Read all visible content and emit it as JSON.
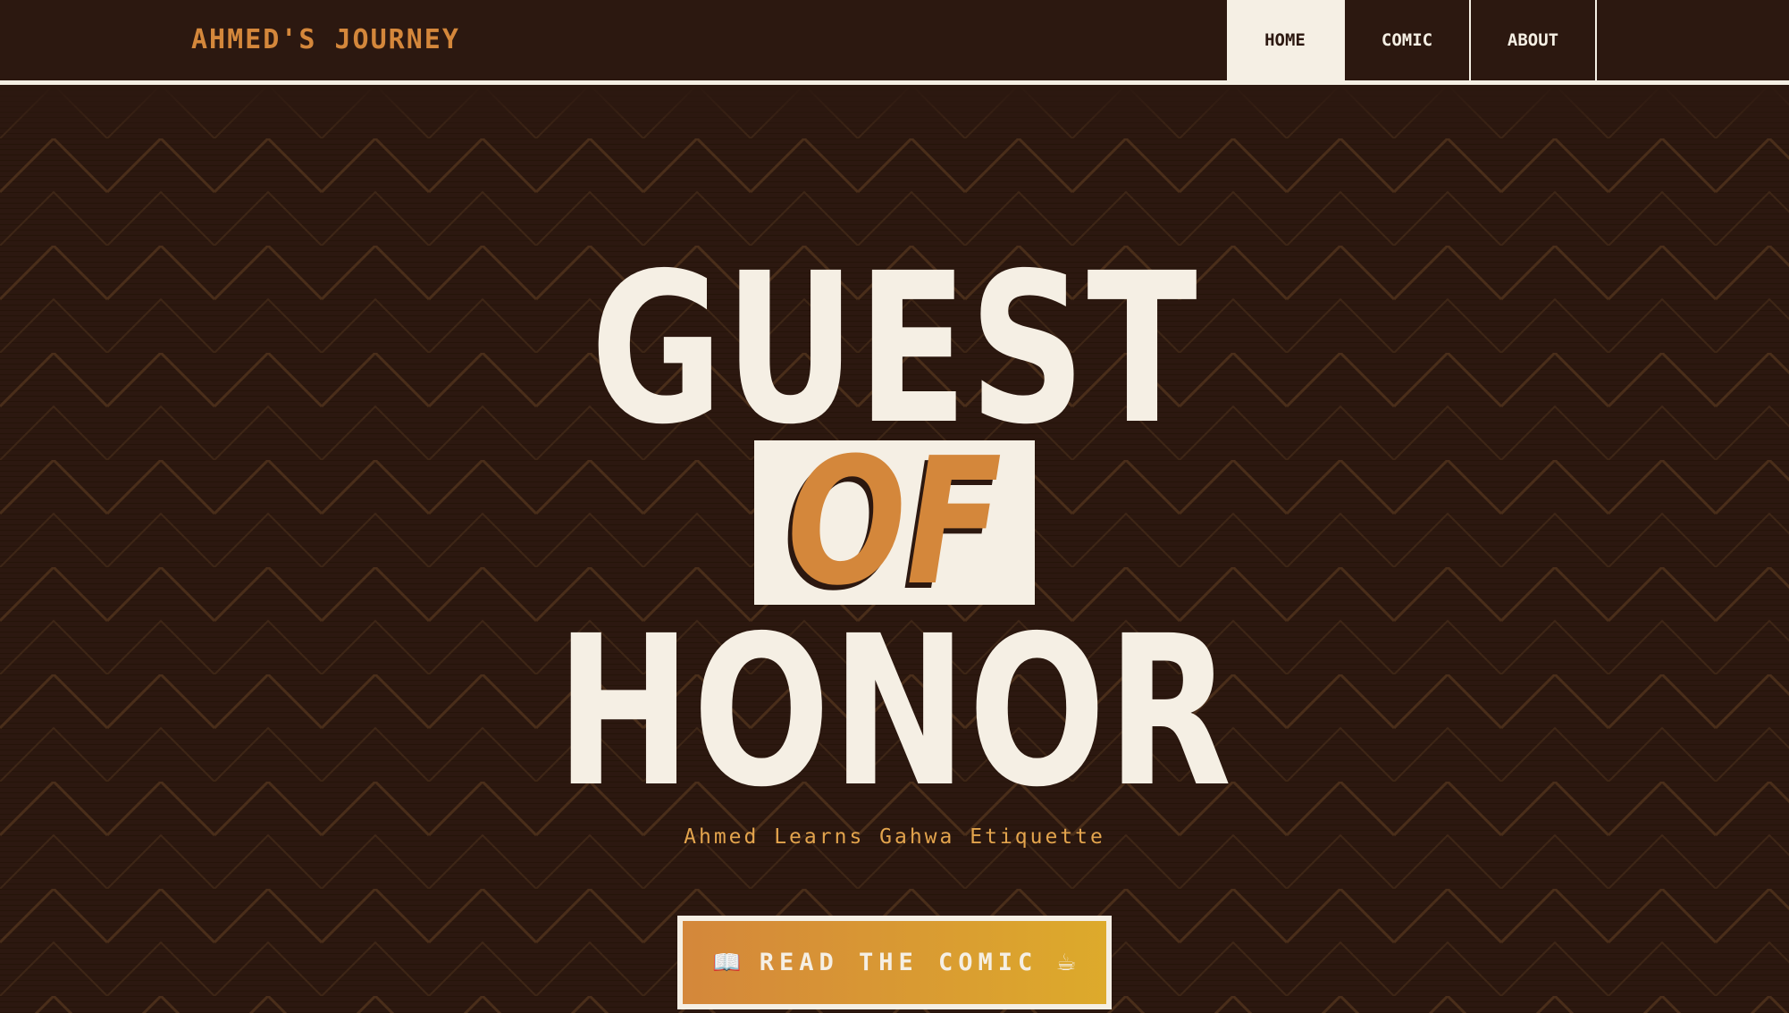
{
  "header": {
    "brand": "AHMED'S JOURNEY",
    "nav": [
      {
        "label": "HOME",
        "active": true
      },
      {
        "label": "COMIC",
        "active": false
      },
      {
        "label": "ABOUT",
        "active": false
      }
    ]
  },
  "hero": {
    "title_line1": "GUEST",
    "title_line2": "OF",
    "title_line3": "HONOR",
    "subtitle": "Ahmed Learns Gahwa Etiquette",
    "cta": {
      "label": "READ THE COMIC",
      "icon_left": "📖",
      "icon_right": "☕",
      "icon_left_name": "open-book-icon",
      "icon_right_name": "coffee-cup-icon"
    },
    "pattern": "chevron-zigzag"
  },
  "colors": {
    "background": "#2c1810",
    "cream": "#f5efe4",
    "accent": "#d4873b",
    "gold": "#ddaa2b",
    "subtitle": "#e3a44d"
  }
}
